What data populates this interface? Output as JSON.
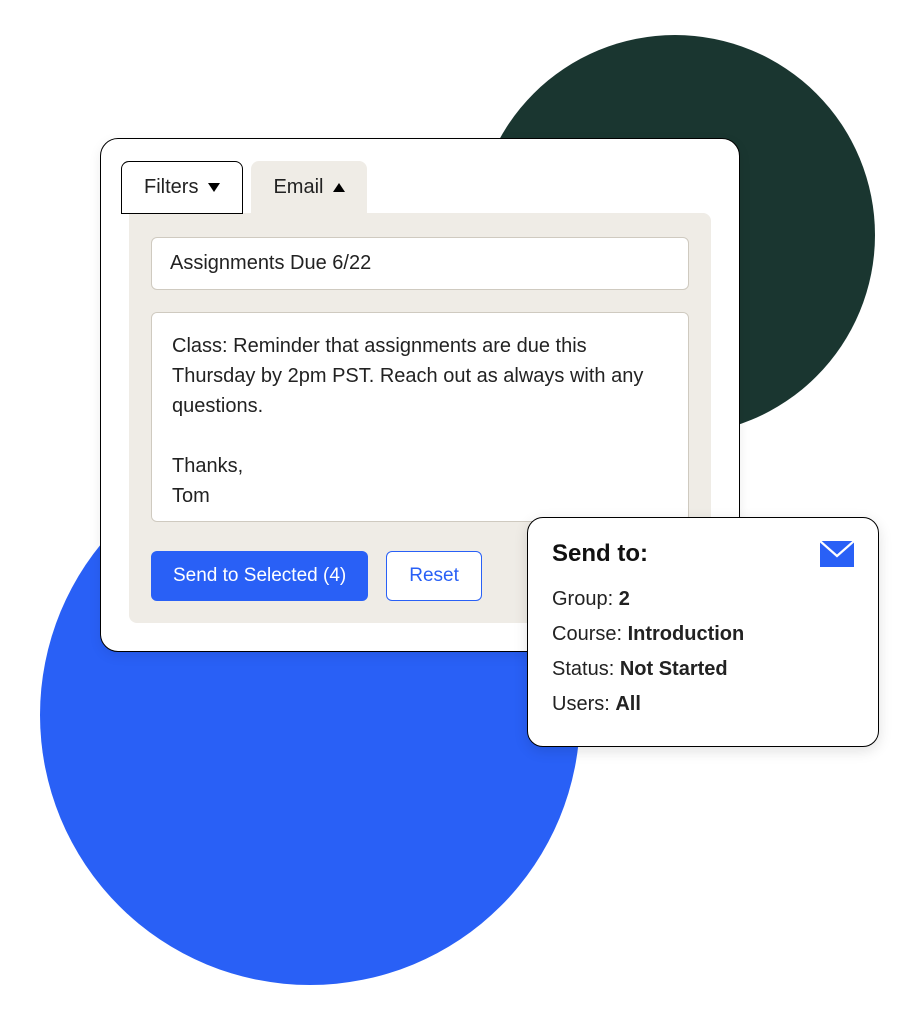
{
  "tabs": {
    "filters_label": "Filters",
    "email_label": "Email"
  },
  "email": {
    "subject": "Assignments Due 6/22",
    "body": "Class: Reminder that assignments are due this Thursday by 2pm PST. Reach out as always with any questions.\n\nThanks,\nTom",
    "send_button": "Send to Selected (4)",
    "reset_button": "Reset"
  },
  "sendto": {
    "title": "Send to:",
    "group_label": "Group: ",
    "group_value": "2",
    "course_label": "Course: ",
    "course_value": "Introduction",
    "status_label": "Status: ",
    "status_value": "Not Started",
    "users_label": "Users: ",
    "users_value": "All"
  },
  "colors": {
    "accent": "#2960f6",
    "dark": "#1a3630",
    "panel": "#efece6"
  }
}
